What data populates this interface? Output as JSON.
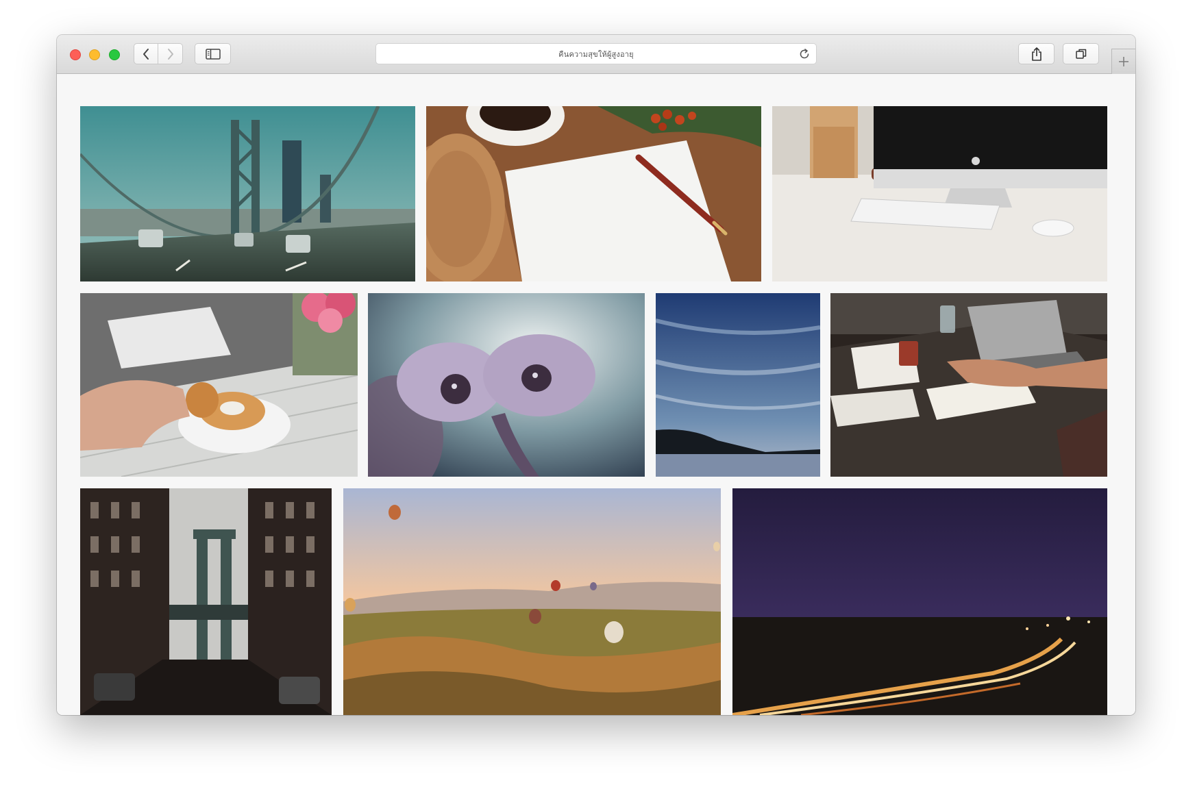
{
  "window": {
    "controls": [
      "close",
      "minimize",
      "zoom"
    ]
  },
  "toolbar": {
    "back_icon": "chevron-left-icon",
    "forward_icon": "chevron-right-icon",
    "sidebar_icon": "sidebar-icon",
    "share_icon": "share-icon",
    "tabs_icon": "tab-overview-icon",
    "new_tab_icon": "plus-icon"
  },
  "address_bar": {
    "text": "คืนความสุขให้ผู้สูงอายุ",
    "reload_icon": "reload-icon"
  },
  "gallery": {
    "photos": [
      {
        "subject": "bridge-road"
      },
      {
        "subject": "coffee-paper-pen"
      },
      {
        "subject": "desk-computer"
      },
      {
        "subject": "donut-table"
      },
      {
        "subject": "purple-flower"
      },
      {
        "subject": "sky-sunset"
      },
      {
        "subject": "people-working-table"
      },
      {
        "subject": "manhattan-bridge-street"
      },
      {
        "subject": "hot-air-balloons"
      },
      {
        "subject": "highway-night"
      }
    ]
  }
}
